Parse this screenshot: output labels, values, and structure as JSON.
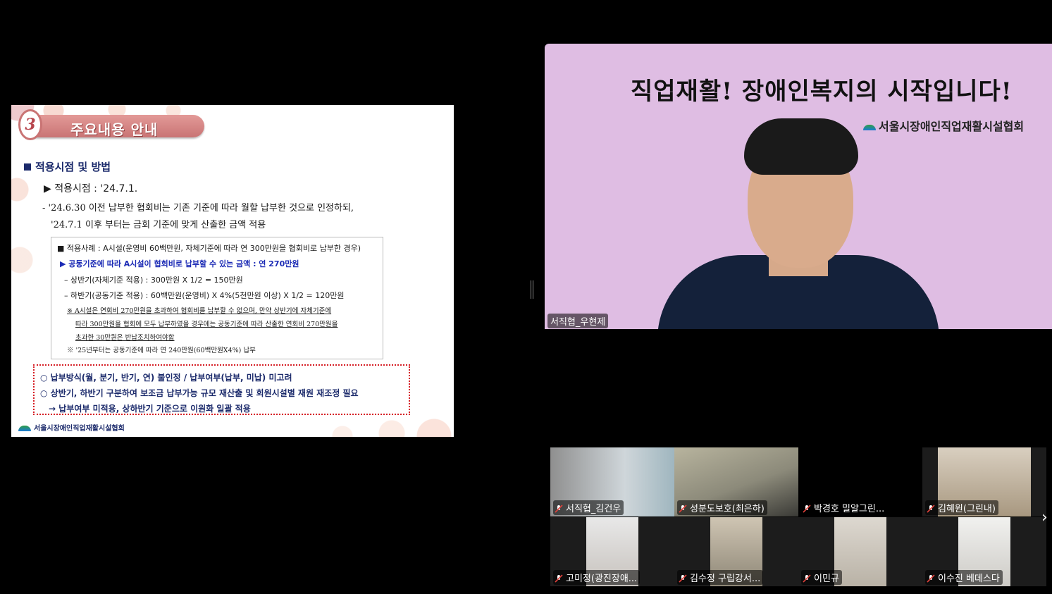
{
  "slide": {
    "number": "3",
    "title": "주요내용 안내",
    "section_heading": "적용시점 및 방법",
    "apply_date": "▶ 적용시점 : '24.7.1.",
    "para1": "- '24.6.30 이전 납부한 협회비는 기존 기준에 따라 월할 납부한 것으로 인정하되,",
    "para2": "'24.7.1 이후 부터는 금회 기준에 맞게 산출한 금액 적용",
    "example": {
      "line1": "■  적용사례 : A시설(운영비 60백만원, 자체기준에 따라 연 300만원을 협회비로 납부한 경우)",
      "line2": "▶ 공동기준에 따라 A시설이 협회비로 납부할 수 있는 금액 : 연 270만원",
      "line3": "– 상반기(자체기준 적용) : 300만원 X 1/2 = 150만원",
      "line4": "– 하반기(공동기준 적용) : 60백만원(운영비) X 4%(5천만원 이상) X 1/2 = 120만원",
      "note1": "※ A시설은 연회비 270만원을 초과하여 협회비를 납부할 수 없으며, 만약 상반기에 자체기준에",
      "note2": "따라 300만원을 협회에 모두 납부하였을 경우에는 공동기준에 따라 산출한 연회비 270만원을",
      "note3": "초과한 30만원은 반납조치하여야함",
      "note4": "※ '25년부터는 공동기준에 따라 연 240만원(60백만원X4%) 납부"
    },
    "red_box": {
      "line1": "○ 납부방식(월, 분기, 반기, 연) 불인정 / 납부여부(납부, 미납) 미고려",
      "line2": "○ 상반기, 하반기 구분하여 보조금 납부가능 규모 재산출 및 회원시설별 재원 재조정 필요",
      "line3": "→ 납부여부 미적용, 상하반기 기준으로 이원화 일괄 적용"
    },
    "footer": "서울시장애인직업재활시설협회"
  },
  "speaker": {
    "banner": "직업재활! 장애인복지의 시작입니다!",
    "org": "서울시장애인직업재활시설협회",
    "name": "서직협_우현제"
  },
  "participants": [
    {
      "name": "서직협_김건우"
    },
    {
      "name": "성분도보호(최은하)"
    },
    {
      "name": "박경호 밀알그린..."
    },
    {
      "name": "김혜원(그린내)"
    },
    {
      "name": "고미정(광진장애..."
    },
    {
      "name": "김수정 구립강서..."
    },
    {
      "name": "이민규"
    },
    {
      "name": "이수진 베데스다"
    }
  ],
  "colors": {
    "muted_mic": "#e0413b",
    "speaker_bg": "#dfbde3",
    "slide_accent": "#c97474"
  }
}
